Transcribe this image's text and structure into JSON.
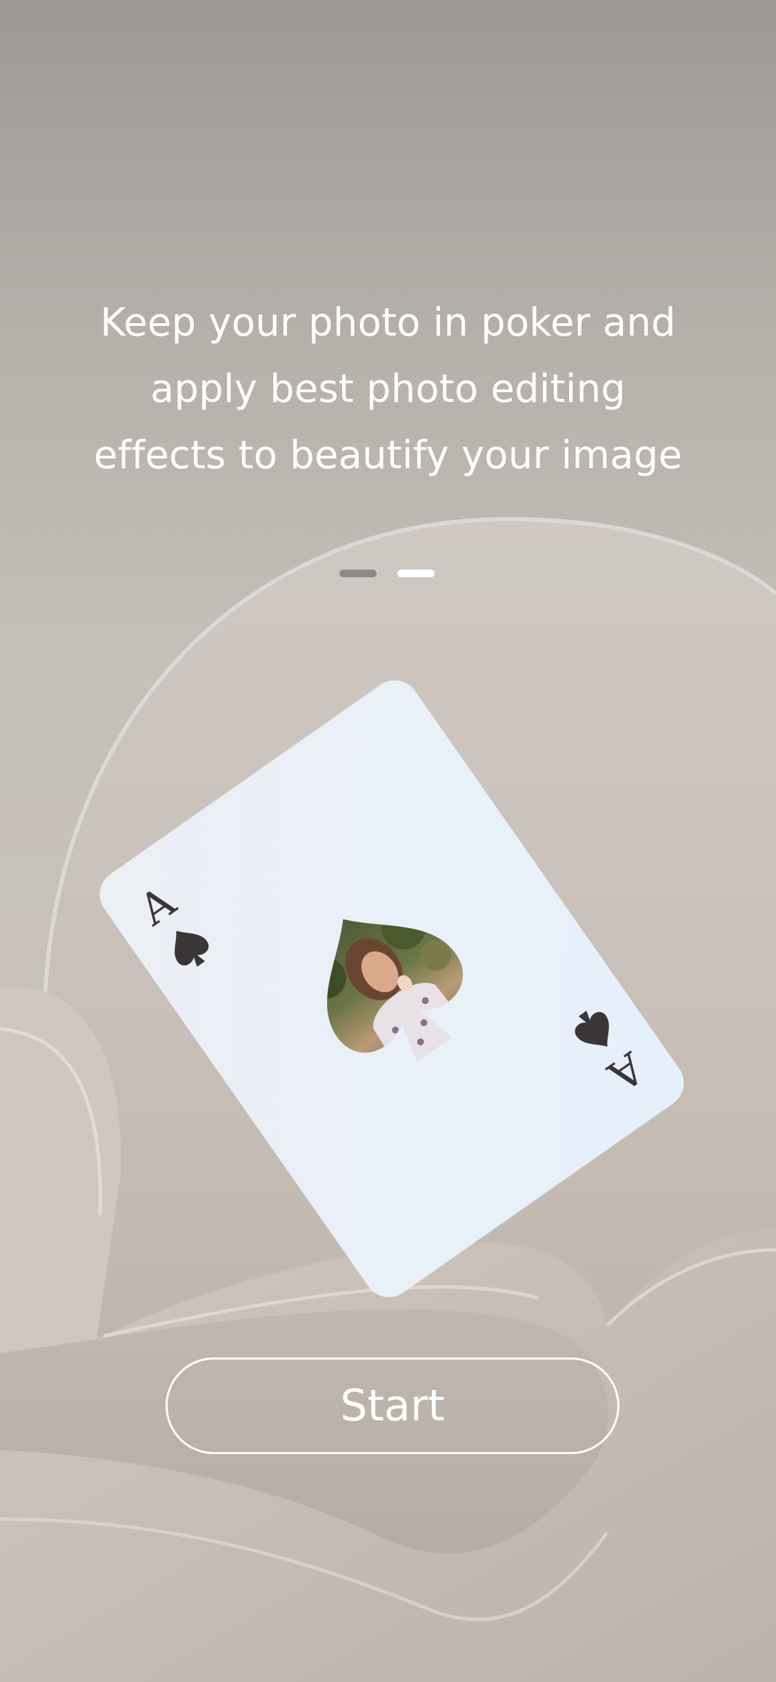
{
  "onboarding": {
    "headline_lines": [
      "Keep your photo in poker and",
      "apply best photo editing",
      "effects to beautify your image"
    ],
    "pager": {
      "total": 2,
      "active_index": 1
    },
    "card": {
      "rank": "A",
      "suit_icon": "spade-icon",
      "photo": "woman-eating-ice-cream-photo"
    },
    "start_label": "Start"
  },
  "colors": {
    "background": "#c6c0ba",
    "text": "#ffffff",
    "indicator_inactive": "#8e8985",
    "indicator_active": "#ffffff",
    "card_face": "#eef3f9",
    "card_ink": "#3a3638"
  }
}
